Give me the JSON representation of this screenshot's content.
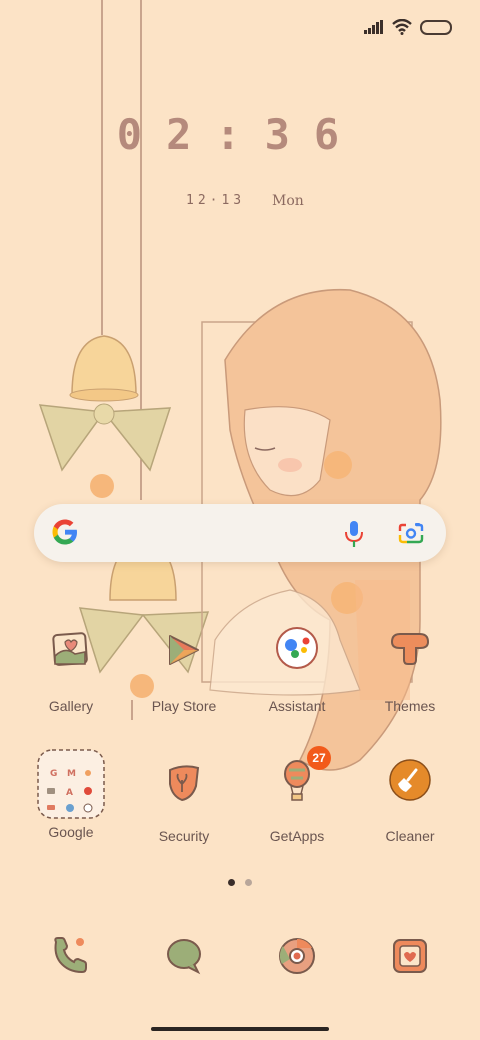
{
  "status_bar": {
    "signal_icon": "signal-bars-icon",
    "wifi_icon": "wifi-icon",
    "battery_icon": "battery-icon"
  },
  "clock": {
    "time": "02:36",
    "date": "12·13",
    "day": "Mon"
  },
  "search": {
    "google_icon": "google-g-icon",
    "mic_icon": "microphone-icon",
    "lens_icon": "google-lens-icon"
  },
  "apps_row1": [
    {
      "label": "Gallery",
      "icon": "gallery-icon"
    },
    {
      "label": "Play Store",
      "icon": "play-store-icon"
    },
    {
      "label": "Assistant",
      "icon": "assistant-icon"
    },
    {
      "label": "Themes",
      "icon": "themes-icon"
    }
  ],
  "apps_row2": [
    {
      "label": "Google",
      "icon": "google-folder-icon"
    },
    {
      "label": "Security",
      "icon": "security-icon"
    },
    {
      "label": "GetApps",
      "icon": "getapps-icon",
      "badge": "27"
    },
    {
      "label": "Cleaner",
      "icon": "cleaner-icon"
    }
  ],
  "folder_apps": [
    "G",
    "M",
    "A"
  ],
  "page_indicator": {
    "pages": 2,
    "current": 1
  },
  "dock": [
    {
      "icon": "phone-icon"
    },
    {
      "icon": "messages-icon"
    },
    {
      "icon": "chrome-icon"
    },
    {
      "icon": "camera-icon"
    }
  ],
  "colors": {
    "background": "#fce3c6",
    "badge": "#f25a1a",
    "accent_orange": "#e58a3a",
    "label": "#6a5550"
  }
}
